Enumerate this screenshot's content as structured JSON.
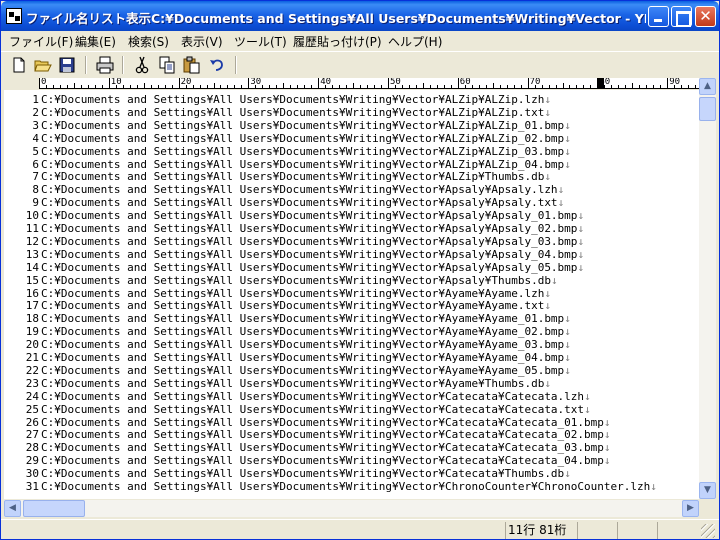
{
  "window": {
    "title": "ファイル名リスト表示C:¥Documents and Settings¥All Users¥Documents¥Writing¥Vector - YEdit...",
    "close_glyph": "✕"
  },
  "menu": [
    "ファイル(F)",
    "編集(E)",
    "検索(S)",
    "表示(V)",
    "ツール(T)",
    "履歴貼っ付け(P)",
    "ヘルプ(H)"
  ],
  "toolbar": {
    "icons": [
      "new-file-icon",
      "open-folder-icon",
      "save-icon",
      "print-icon",
      "cut-icon",
      "copy-icon",
      "paste-icon",
      "undo-icon"
    ]
  },
  "ruler": {
    "labels": [
      "0",
      "10",
      "20",
      "30",
      "40",
      "50",
      "60",
      "70",
      "80",
      "90"
    ],
    "cursor_column": 80
  },
  "editor": {
    "eol_mark": "↓",
    "lines": [
      {
        "n": "1",
        "text": "C:¥Documents and Settings¥All Users¥Documents¥Writing¥Vector¥ALZip¥ALZip.lzh",
        "eol": true
      },
      {
        "n": "2",
        "text": "C:¥Documents and Settings¥All Users¥Documents¥Writing¥Vector¥ALZip¥ALZip.txt",
        "eol": true
      },
      {
        "n": "3",
        "text": "C:¥Documents and Settings¥All Users¥Documents¥Writing¥Vector¥ALZip¥ALZip_01.bmp",
        "eol": true
      },
      {
        "n": "4",
        "text": "C:¥Documents and Settings¥All Users¥Documents¥Writing¥Vector¥ALZip¥ALZip_02.bmp",
        "eol": true
      },
      {
        "n": "5",
        "text": "C:¥Documents and Settings¥All Users¥Documents¥Writing¥Vector¥ALZip¥ALZip_03.bmp",
        "eol": true
      },
      {
        "n": "6",
        "text": "C:¥Documents and Settings¥All Users¥Documents¥Writing¥Vector¥ALZip¥ALZip_04.bmp",
        "eol": true
      },
      {
        "n": "7",
        "text": "C:¥Documents and Settings¥All Users¥Documents¥Writing¥Vector¥ALZip¥Thumbs.db",
        "eol": true
      },
      {
        "n": "8",
        "text": "C:¥Documents and Settings¥All Users¥Documents¥Writing¥Vector¥Apsaly¥Apsaly.lzh",
        "eol": true
      },
      {
        "n": "9",
        "text": "C:¥Documents and Settings¥All Users¥Documents¥Writing¥Vector¥Apsaly¥Apsaly.txt",
        "eol": true
      },
      {
        "n": "10",
        "text": "C:¥Documents and Settings¥All Users¥Documents¥Writing¥Vector¥Apsaly¥Apsaly_01.bmp",
        "eol": true
      },
      {
        "n": "11",
        "text": "C:¥Documents and Settings¥All Users¥Documents¥Writing¥Vector¥Apsaly¥Apsaly_02.bmp",
        "eol": true
      },
      {
        "n": "12",
        "text": "C:¥Documents and Settings¥All Users¥Documents¥Writing¥Vector¥Apsaly¥Apsaly_03.bmp",
        "eol": true
      },
      {
        "n": "13",
        "text": "C:¥Documents and Settings¥All Users¥Documents¥Writing¥Vector¥Apsaly¥Apsaly_04.bmp",
        "eol": true
      },
      {
        "n": "14",
        "text": "C:¥Documents and Settings¥All Users¥Documents¥Writing¥Vector¥Apsaly¥Apsaly_05.bmp",
        "eol": true
      },
      {
        "n": "15",
        "text": "C:¥Documents and Settings¥All Users¥Documents¥Writing¥Vector¥Apsaly¥Thumbs.db",
        "eol": true
      },
      {
        "n": "16",
        "text": "C:¥Documents and Settings¥All Users¥Documents¥Writing¥Vector¥Ayame¥Ayame.lzh",
        "eol": true
      },
      {
        "n": "17",
        "text": "C:¥Documents and Settings¥All Users¥Documents¥Writing¥Vector¥Ayame¥Ayame.txt",
        "eol": true
      },
      {
        "n": "18",
        "text": "C:¥Documents and Settings¥All Users¥Documents¥Writing¥Vector¥Ayame¥Ayame_01.bmp",
        "eol": true
      },
      {
        "n": "19",
        "text": "C:¥Documents and Settings¥All Users¥Documents¥Writing¥Vector¥Ayame¥Ayame_02.bmp",
        "eol": true
      },
      {
        "n": "20",
        "text": "C:¥Documents and Settings¥All Users¥Documents¥Writing¥Vector¥Ayame¥Ayame_03.bmp",
        "eol": true
      },
      {
        "n": "21",
        "text": "C:¥Documents and Settings¥All Users¥Documents¥Writing¥Vector¥Ayame¥Ayame_04.bmp",
        "eol": true
      },
      {
        "n": "22",
        "text": "C:¥Documents and Settings¥All Users¥Documents¥Writing¥Vector¥Ayame¥Ayame_05.bmp",
        "eol": true
      },
      {
        "n": "23",
        "text": "C:¥Documents and Settings¥All Users¥Documents¥Writing¥Vector¥Ayame¥Thumbs.db",
        "eol": true
      },
      {
        "n": "24",
        "text": "C:¥Documents and Settings¥All Users¥Documents¥Writing¥Vector¥Catecata¥Catecata.lzh",
        "eol": true
      },
      {
        "n": "25",
        "text": "C:¥Documents and Settings¥All Users¥Documents¥Writing¥Vector¥Catecata¥Catecata.txt",
        "eol": true
      },
      {
        "n": "26",
        "text": "C:¥Documents and Settings¥All Users¥Documents¥Writing¥Vector¥Catecata¥Catecata_01.bmp",
        "eol": true
      },
      {
        "n": "27",
        "text": "C:¥Documents and Settings¥All Users¥Documents¥Writing¥Vector¥Catecata¥Catecata_02.bmp",
        "eol": true
      },
      {
        "n": "28",
        "text": "C:¥Documents and Settings¥All Users¥Documents¥Writing¥Vector¥Catecata¥Catecata_03.bmp",
        "eol": true
      },
      {
        "n": "29",
        "text": "C:¥Documents and Settings¥All Users¥Documents¥Writing¥Vector¥Catecata¥Catecata_04.bmp",
        "eol": true
      },
      {
        "n": "30",
        "text": "C:¥Documents and Settings¥All Users¥Documents¥Writing¥Vector¥Catecata¥Thumbs.db",
        "eol": true
      },
      {
        "n": "31",
        "text": "C:¥Documents and Settings¥All Users¥Documents¥Writing¥Vector¥ChronoCounter¥ChronoCounter.lzh",
        "eol": true
      }
    ]
  },
  "statusbar": {
    "position": "11行 81桁"
  },
  "colors": {
    "titlebar": "#0a5fe0",
    "chrome": "#ece9d8",
    "eol_mark": "#808080"
  }
}
